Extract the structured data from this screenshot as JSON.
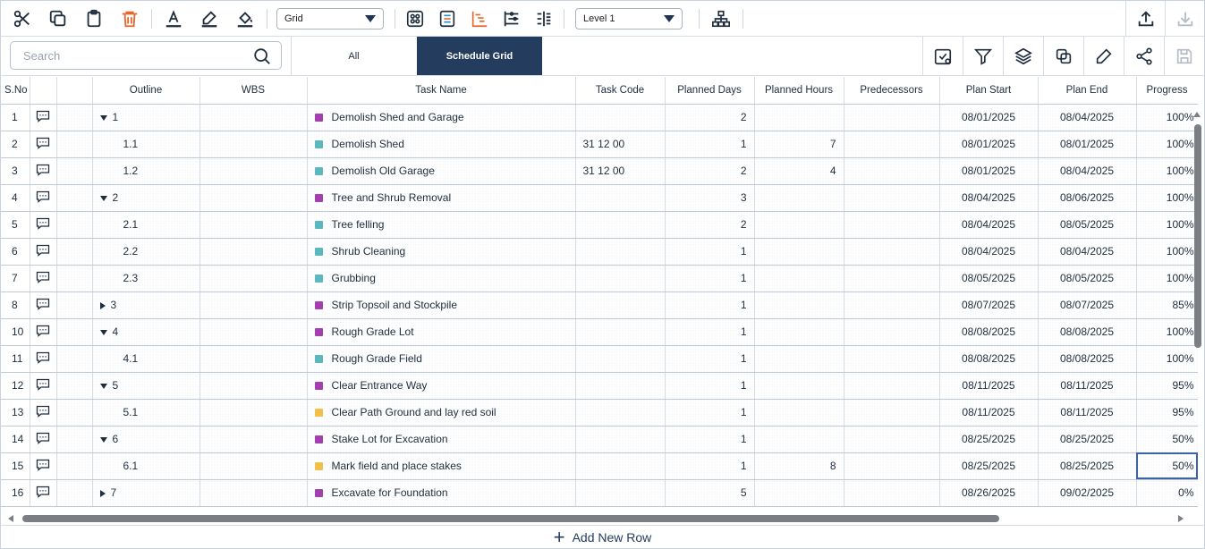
{
  "toolbar": {
    "view_select": "Grid",
    "level_select": "Level 1",
    "colors": {
      "accent": "#243c5e",
      "delete": "#e8662b",
      "timeline": "#e8662b"
    }
  },
  "search": {
    "placeholder": "Search"
  },
  "tabs": [
    {
      "label": "All"
    },
    {
      "label": "Schedule Grid",
      "active": true
    }
  ],
  "grid": {
    "columns": [
      "S.No",
      "",
      "",
      "Outline",
      "WBS",
      "Task Name",
      "Task Code",
      "Planned Days",
      "Planned Hours",
      "Predecessors",
      "Plan Start",
      "Plan End",
      "Progress"
    ],
    "rows": [
      {
        "sno": "1",
        "outline": "1",
        "expander": "down",
        "wbs": "",
        "task": "Demolish Shed and Garage",
        "color": "#a43fb0",
        "code": "",
        "days": "2",
        "hours": "",
        "pred": "",
        "start": "08/01/2025",
        "end": "08/04/2025",
        "progress": "100%"
      },
      {
        "sno": "2",
        "outline": "1.1",
        "expander": "",
        "wbs": "",
        "task": "Demolish Shed",
        "color": "#5ab8be",
        "code": "31 12 00",
        "days": "1",
        "hours": "7",
        "pred": "",
        "start": "08/01/2025",
        "end": "08/01/2025",
        "progress": "100%"
      },
      {
        "sno": "3",
        "outline": "1.2",
        "expander": "",
        "wbs": "",
        "task": "Demolish Old Garage",
        "color": "#5ab8be",
        "code": "31 12 00",
        "days": "2",
        "hours": "4",
        "pred": "",
        "start": "08/01/2025",
        "end": "08/04/2025",
        "progress": "100%"
      },
      {
        "sno": "4",
        "outline": "2",
        "expander": "down",
        "wbs": "",
        "task": "Tree and Shrub Removal",
        "color": "#a43fb0",
        "code": "",
        "days": "3",
        "hours": "",
        "pred": "",
        "start": "08/04/2025",
        "end": "08/06/2025",
        "progress": "100%"
      },
      {
        "sno": "5",
        "outline": "2.1",
        "expander": "",
        "wbs": "",
        "task": "Tree felling",
        "color": "#5ab8be",
        "code": "",
        "days": "2",
        "hours": "",
        "pred": "",
        "start": "08/04/2025",
        "end": "08/05/2025",
        "progress": "100%"
      },
      {
        "sno": "6",
        "outline": "2.2",
        "expander": "",
        "wbs": "",
        "task": "Shrub Cleaning",
        "color": "#5ab8be",
        "code": "",
        "days": "1",
        "hours": "",
        "pred": "",
        "start": "08/04/2025",
        "end": "08/04/2025",
        "progress": "100%"
      },
      {
        "sno": "7",
        "outline": "2.3",
        "expander": "",
        "wbs": "",
        "task": "Grubbing",
        "color": "#5ab8be",
        "code": "",
        "days": "1",
        "hours": "",
        "pred": "",
        "start": "08/05/2025",
        "end": "08/05/2025",
        "progress": "100%"
      },
      {
        "sno": "8",
        "outline": "3",
        "expander": "right",
        "wbs": "",
        "task": "Strip Topsoil and Stockpile",
        "color": "#a43fb0",
        "code": "",
        "days": "1",
        "hours": "",
        "pred": "",
        "start": "08/07/2025",
        "end": "08/07/2025",
        "progress": "85%"
      },
      {
        "sno": "10",
        "outline": "4",
        "expander": "down",
        "wbs": "",
        "task": "Rough Grade Lot",
        "color": "#a43fb0",
        "code": "",
        "days": "1",
        "hours": "",
        "pred": "",
        "start": "08/08/2025",
        "end": "08/08/2025",
        "progress": "100%"
      },
      {
        "sno": "11",
        "outline": "4.1",
        "expander": "",
        "wbs": "",
        "task": "Rough Grade Field",
        "color": "#5ab8be",
        "code": "",
        "days": "1",
        "hours": "",
        "pred": "",
        "start": "08/08/2025",
        "end": "08/08/2025",
        "progress": "100%"
      },
      {
        "sno": "12",
        "outline": "5",
        "expander": "down",
        "wbs": "",
        "task": "Clear Entrance Way",
        "color": "#a43fb0",
        "code": "",
        "days": "1",
        "hours": "",
        "pred": "",
        "start": "08/11/2025",
        "end": "08/11/2025",
        "progress": "95%"
      },
      {
        "sno": "13",
        "outline": "5.1",
        "expander": "",
        "wbs": "",
        "task": "Clear Path Ground and lay red soil",
        "color": "#f0c04a",
        "code": "",
        "days": "1",
        "hours": "",
        "pred": "",
        "start": "08/11/2025",
        "end": "08/11/2025",
        "progress": "95%"
      },
      {
        "sno": "14",
        "outline": "6",
        "expander": "down",
        "wbs": "",
        "task": "Stake Lot for Excavation",
        "color": "#a43fb0",
        "code": "",
        "days": "1",
        "hours": "",
        "pred": "",
        "start": "08/25/2025",
        "end": "08/25/2025",
        "progress": "50%"
      },
      {
        "sno": "15",
        "outline": "6.1",
        "expander": "",
        "wbs": "",
        "task": "Mark field and place stakes",
        "color": "#f0c04a",
        "code": "",
        "days": "1",
        "hours": "8",
        "pred": "",
        "start": "08/25/2025",
        "end": "08/25/2025",
        "progress": "50%",
        "selected": "progress"
      },
      {
        "sno": "16",
        "outline": "7",
        "expander": "right",
        "wbs": "",
        "task": "Excavate for Foundation",
        "color": "#a43fb0",
        "code": "",
        "days": "5",
        "hours": "",
        "pred": "",
        "start": "08/26/2025",
        "end": "09/02/2025",
        "progress": "0%"
      }
    ]
  },
  "footer": {
    "add_row_label": "Add New Row"
  }
}
